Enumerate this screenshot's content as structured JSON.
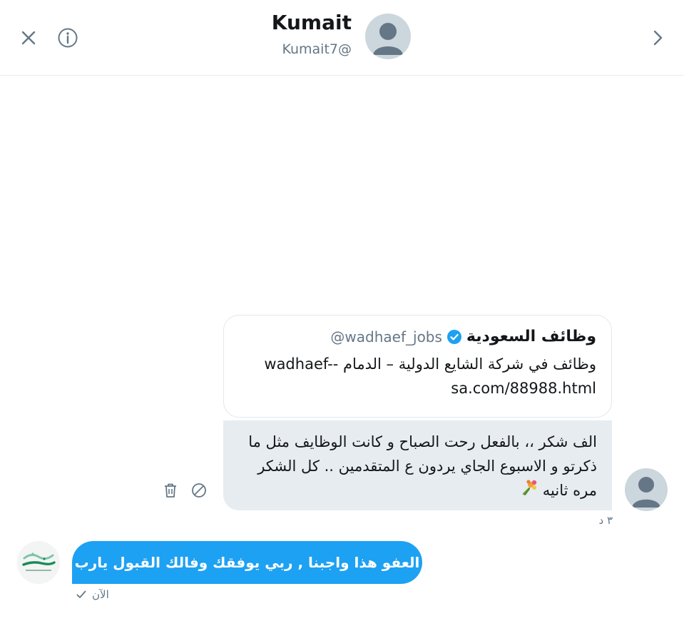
{
  "header": {
    "name": "Kumait",
    "handle": "Kumait7@",
    "close_icon": "close-icon",
    "info_icon": "info-icon",
    "next_icon": "chevron-right-icon"
  },
  "shared_tweet": {
    "name": "وظائف السعودية",
    "handle": "@wadhaef_jobs",
    "text": "وظائف في شركة الشايع الدولية – الدمام -wadhaef-sa.com/88988.html",
    "verified_icon": "verified-badge-icon"
  },
  "incoming_message": {
    "text": "الف شكر ،، بالفعل رحت الصباح و كانت الوظايف مثل ما ذكرتو و الاسبوع الجاي يردون ع المتقدمين .. كل الشكر مره ثانيه",
    "emoji_icon": "bouquet-icon",
    "time": "٣ د",
    "delete_icon": "trash-icon",
    "block_icon": "block-icon"
  },
  "outgoing_message": {
    "text": "العفو هذا واجبنا , ربي يوفقك وفالك القبول يارب",
    "status": "الآن",
    "status_icon": "checkmark-icon"
  },
  "colors": {
    "accent": "#1da1f2",
    "incoming_bubble": "#e6ecf0",
    "secondary_text": "#657786",
    "border": "#e6ecf0"
  }
}
